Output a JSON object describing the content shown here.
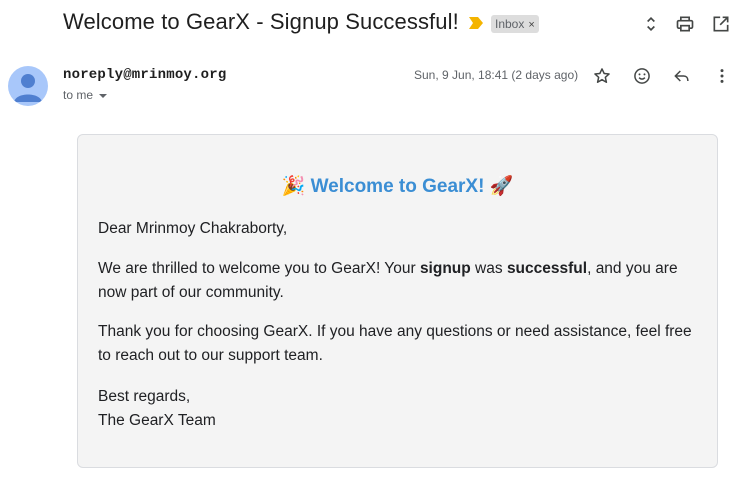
{
  "email": {
    "subject": "Welcome to GearX - Signup Successful!",
    "label": "Inbox",
    "label_close": "×",
    "sender_email": "noreply@mrinmoy.org",
    "to": "to me",
    "date": "Sun, 9 Jun, 18:41 (2 days ago)"
  },
  "body": {
    "heading_emoji_left": "🎉",
    "heading": "Welcome to GearX!",
    "heading_emoji_right": "🚀",
    "greeting": "Dear Mrinmoy Chakraborty,",
    "p1_a": "We are thrilled to welcome you to GearX! Your ",
    "p1_b": "signup",
    "p1_c": " was ",
    "p1_d": "successful",
    "p1_e": ", and you are now part of our community.",
    "p2": "Thank you for choosing GearX. If you have any questions or need assistance, feel free to reach out to our support team.",
    "signoff": "Best regards,",
    "signature": "The GearX Team"
  },
  "colors": {
    "heading": "#3b8ed4",
    "important_marker": "#f4b400",
    "avatar_bg": "#a8c7fa",
    "avatar_fg": "#4f7fd0"
  },
  "icons": {
    "top_actions": [
      "expand-collapse-icon",
      "print-icon",
      "open-in-new-window-icon"
    ],
    "message_actions": [
      "star-icon",
      "emoji-reaction-icon",
      "reply-icon",
      "more-vert-icon"
    ]
  }
}
